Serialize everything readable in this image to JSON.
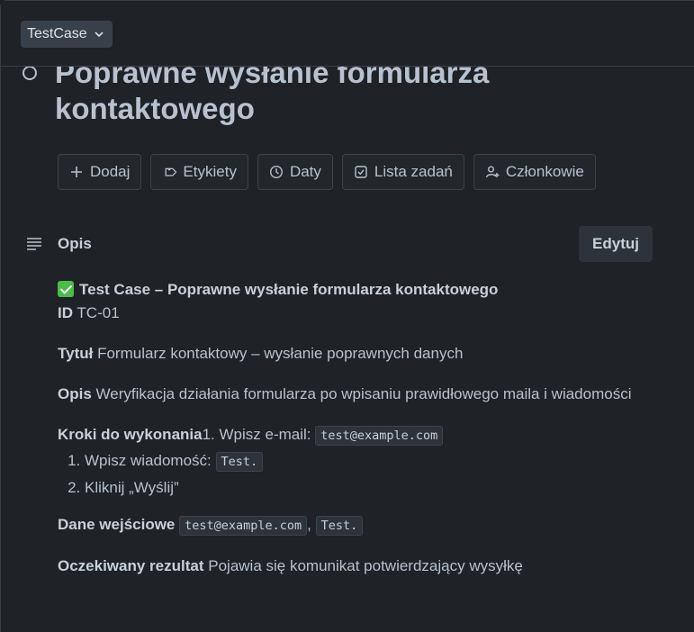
{
  "list": {
    "label": "TestCase"
  },
  "card": {
    "title": "Poprawne wysłanie formularza kontaktowego"
  },
  "actions": [
    {
      "label": "Dodaj",
      "icon": "plus-icon"
    },
    {
      "label": "Etykiety",
      "icon": "tag-icon"
    },
    {
      "label": "Daty",
      "icon": "clock-icon"
    },
    {
      "label": "Lista zadań",
      "icon": "checklist-icon"
    },
    {
      "label": "Członkowie",
      "icon": "member-icon"
    }
  ],
  "description": {
    "label": "Opis",
    "edit_label": "Edytuj",
    "heading": "Test Case  – Poprawne wysłanie formularza kontaktowego",
    "id_label": "ID",
    "id_value": "TC-01",
    "title_label": "Tytuł",
    "title_value": "Formularz kontaktowy – wysłanie poprawnych danych",
    "desc_label": "Opis",
    "desc_value": "Weryfikacja działania formularza po wpisaniu prawidłowego maila i wiadomości",
    "steps_label": "Kroki do wykonania",
    "step0_text": "1. Wpisz e-mail:",
    "step0_code": "test@example.com",
    "steps": [
      {
        "text": "Wpisz wiadomość:",
        "code": "Test."
      },
      {
        "text": "Kliknij „Wyślij”"
      }
    ],
    "input_label": "Dane wejściowe",
    "input_code1": "test@example.com",
    "input_sep": ",",
    "input_code2": "Test.",
    "result_label": "Oczekiwany rezultat",
    "result_value": "Pojawia się komunikat potwierdzający wysyłkę"
  },
  "colors": {
    "background": "#1f2226",
    "text": "#b6c2cf",
    "chip": "#38414a",
    "check": "#4cbb4a"
  }
}
